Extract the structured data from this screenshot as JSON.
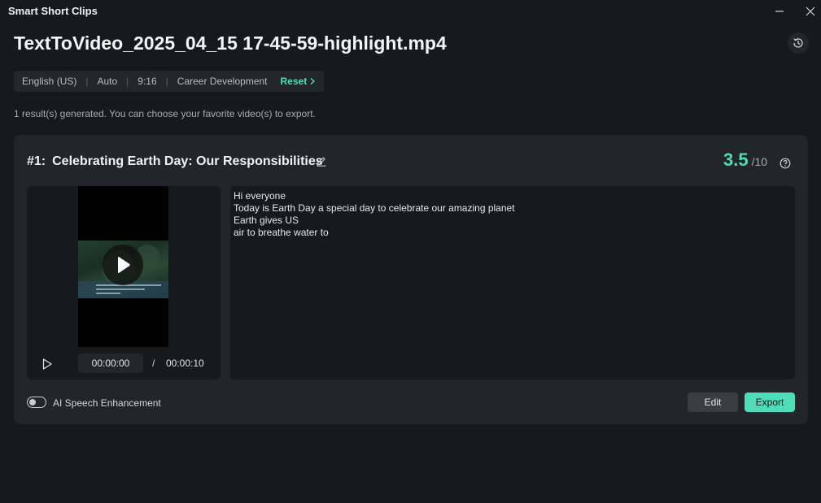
{
  "window": {
    "title": "Smart Short Clips"
  },
  "header": {
    "file_title": "TextToVideo_2025_04_15 17-45-59-highlight.mp4"
  },
  "settings": {
    "items": [
      "English (US)",
      "Auto",
      "9:16",
      "Career Development"
    ],
    "reset_label": "Reset"
  },
  "result_message": "1 result(s) generated. You can choose your favorite video(s) to export.",
  "clip": {
    "number": "#1:",
    "title": "Celebrating Earth Day: Our Responsibilities",
    "score": "3.5",
    "score_max": "/10",
    "time_current": "00:00:00",
    "time_separator": "/",
    "time_total": "00:00:10",
    "transcript": [
      "Hi everyone",
      "Today is Earth Day a special day to celebrate our amazing planet",
      "Earth gives US",
      "air to breathe water to"
    ]
  },
  "footer": {
    "ai_speech_label": "AI Speech Enhancement",
    "ai_speech_enabled": false,
    "edit_label": "Edit",
    "export_label": "Export"
  },
  "colors": {
    "accent": "#4fdcb8",
    "background": "#17191c",
    "card": "#222529"
  }
}
